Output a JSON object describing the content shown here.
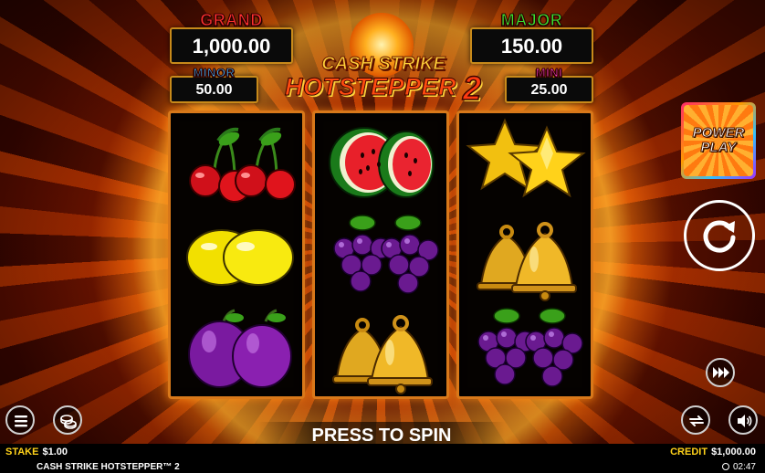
{
  "jackpots": {
    "grand": {
      "title": "GRAND",
      "value": "1,000.00",
      "color": "#ff3030"
    },
    "major": {
      "title": "MAJOR",
      "value": "150.00",
      "color": "#38e030"
    },
    "minor": {
      "title": "MINOR",
      "value": "50.00",
      "color": "#40b8ff"
    },
    "mini": {
      "title": "MINI",
      "value": "25.00",
      "color": "#ff40c8"
    }
  },
  "logo": {
    "line1": "CASH STRIKE",
    "line2": "HOTSTEPPER",
    "number": "2"
  },
  "reels": [
    [
      "cherries-icon",
      "lemons-icon",
      "plums-icon"
    ],
    [
      "watermelon-icon",
      "grapes-icon",
      "bells-icon"
    ],
    [
      "stars-icon",
      "bells-icon",
      "grapes-icon"
    ]
  ],
  "side": {
    "power_play_line1": "POWER",
    "power_play_line2": "PLAY",
    "spin_icon": "spin-icon",
    "turbo_icon": "fast-forward-icon"
  },
  "controls": {
    "menu_icon": "hamburger-menu-icon",
    "coins_icon": "coins-icon",
    "autoplay_icon": "autoplay-icon",
    "sound_icon": "speaker-icon",
    "press_to_spin": "PRESS TO SPIN"
  },
  "status": {
    "stake_label": "STAKE",
    "stake_value": "$1.00",
    "credit_label": "CREDIT",
    "credit_value": "$1,000.00",
    "game_name": "CASH STRIKE HOTSTEPPER™ 2",
    "time": "02:47"
  },
  "colors": {
    "accent_gold": "#ffd21a",
    "reel_border": "#d8781a"
  }
}
